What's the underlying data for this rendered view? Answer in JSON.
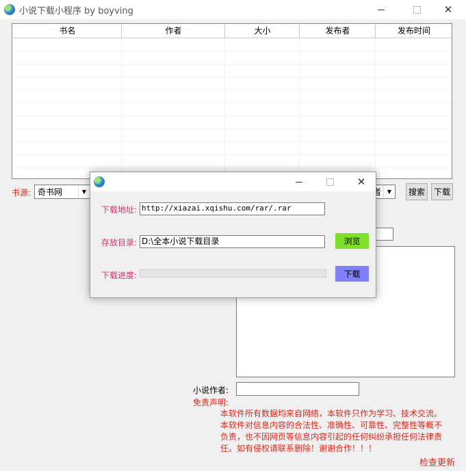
{
  "window": {
    "title": "小说下载小程序  by boyving"
  },
  "table": {
    "columns": [
      "书名",
      "作者",
      "大小",
      "发布者",
      "发布时间"
    ],
    "rows": []
  },
  "source": {
    "label": "书源:",
    "selected": "奇书网",
    "secondary_selected": "者"
  },
  "buttons": {
    "search": "搜索",
    "download": "下载",
    "check_update": "检查更新"
  },
  "author": {
    "label": "小说作者:",
    "value": ""
  },
  "disclaimer": {
    "label": "免责声明:",
    "lines": [
      "本软件所有数据均来自网络，本软件只作为学习、技术交流。",
      "本软件对信息内容的合法性、准确性、可靠性、完整性等概不",
      "负责，也不因网页等信息内容引起的任何纠纷承担任何法律责",
      "任。如有侵权请联系删除！谢谢合作！！！"
    ]
  },
  "dialog": {
    "url_label": "下载地址:",
    "url_value": "http://xiazai.xqishu.com/rar/.rar",
    "dir_label": "存放目录:",
    "dir_value": "D:\\全本小说下载目录",
    "browse_button": "浏览",
    "progress_label": "下载进度:",
    "progress_value": 0,
    "download_button": "下载",
    "browse_color": "#7fe02a",
    "download_color": "#8080f8"
  },
  "colors": {
    "accent_red": "#e0251b",
    "label_pink": "#d9326e"
  }
}
